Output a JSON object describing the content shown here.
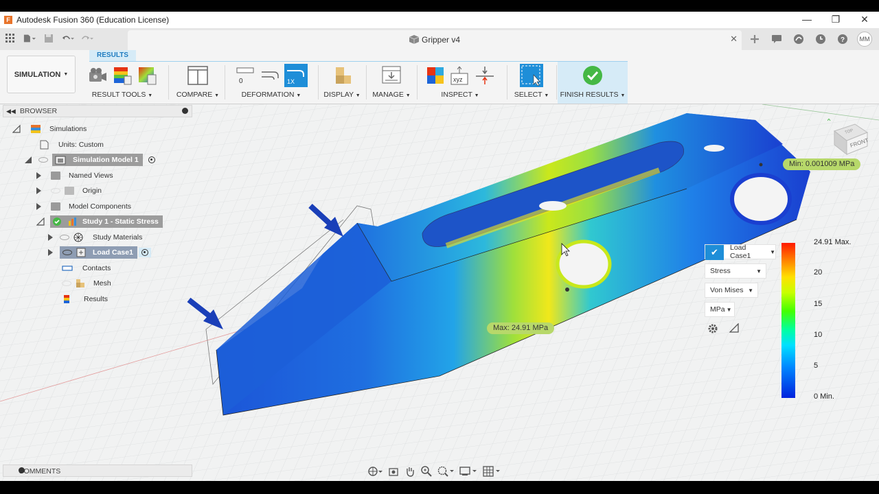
{
  "window": {
    "title": "Autodesk Fusion 360 (Education License)",
    "logo_letter": "F",
    "minimize": "—",
    "maximize": "❐",
    "close": "✕"
  },
  "document": {
    "tab_title": "Gripper v4",
    "close": "✕"
  },
  "user": {
    "initials": "MM"
  },
  "ribbon": {
    "workspace": "SIMULATION",
    "active_tab": "RESULTS",
    "groups": {
      "result_tools": "RESULT TOOLS",
      "compare": "COMPARE",
      "deformation": "DEFORMATION",
      "display": "DISPLAY",
      "manage": "MANAGE",
      "inspect": "INSPECT",
      "select": "SELECT",
      "finish": "FINISH RESULTS"
    },
    "deformation_zero": "0",
    "deformation_scale": "1X",
    "inspect_xyz": "xyz"
  },
  "browser": {
    "title": "BROWSER",
    "items": [
      {
        "label": "Simulations"
      },
      {
        "label": "Units: Custom"
      },
      {
        "label": "Simulation Model 1"
      },
      {
        "label": "Named Views"
      },
      {
        "label": "Origin"
      },
      {
        "label": "Model Components"
      },
      {
        "label": "Study 1 - Static Stress"
      },
      {
        "label": "Study Materials"
      },
      {
        "label": "Load Case1"
      },
      {
        "label": "Contacts"
      },
      {
        "label": "Mesh"
      },
      {
        "label": "Results"
      }
    ]
  },
  "comments": {
    "title": "COMMENTS"
  },
  "results": {
    "min_label": "Min: 0.001009 MPa",
    "max_label": "Max: 24.91 MPa",
    "load_case": "Load Case1",
    "result_type": "Stress",
    "component": "Von Mises",
    "unit": "MPa",
    "legend_ticks": [
      "24.91 Max.",
      "20",
      "15",
      "10",
      "5",
      "0 Min."
    ],
    "colors": {
      "high": "#ff1a00",
      "mid": "#44ff00",
      "low": "#0022dd",
      "accent": "#1e8ed8",
      "pill": "#b7d86a"
    }
  },
  "viewcube": {
    "face": "FRONT",
    "top": "TOP"
  }
}
